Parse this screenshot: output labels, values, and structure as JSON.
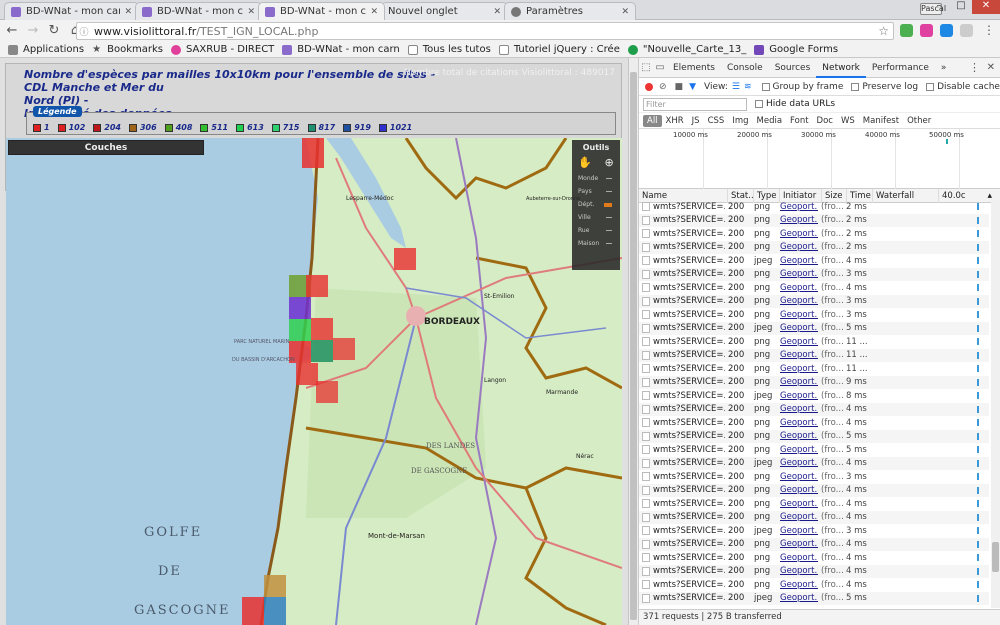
{
  "browser": {
    "tabs": [
      {
        "label": "BD-WNat - mon carnet d",
        "active": false
      },
      {
        "label": "BD-WNat - mon carnet d",
        "active": false
      },
      {
        "label": "BD-WNat - mon carnet d",
        "active": true
      },
      {
        "label": "Nouvel onglet",
        "active": false
      },
      {
        "label": "Paramètres",
        "active": false
      }
    ],
    "profile": "Pascal",
    "url_host": "www.visiolittoral.fr",
    "url_path": "/TEST_IGN_LOCAL.php",
    "bookmarks": [
      {
        "label": "Applications",
        "icon": "apps-grid-icon"
      },
      {
        "label": "Bookmarks",
        "icon": "star-icon"
      },
      {
        "label": "SAXRUB - DIRECT",
        "icon": "saxrub-icon"
      },
      {
        "label": "BD-WNat - mon carn",
        "icon": "bdwnat-icon"
      },
      {
        "label": "Tous les tutos",
        "icon": "page-icon"
      },
      {
        "label": "Tutoriel jQuery : Crée",
        "icon": "page-icon"
      },
      {
        "label": "\"Nouvelle_Carte_13_",
        "icon": "sheets-icon"
      },
      {
        "label": "Google Forms",
        "icon": "forms-icon"
      }
    ]
  },
  "page": {
    "title_line1": "Nombre d'espèces par mailles 10x10km pour l'ensemble de sites - CDL Manche et Mer du",
    "title_line2": "Nord (PI) -",
    "title_line3": "Intégralité des données",
    "total_count": "Nombre total de citations Visiolittoral : 489017",
    "legend_title": "Légende",
    "legend": [
      {
        "label": "1",
        "color": "#e02020"
      },
      {
        "label": "102",
        "color": "#e02020"
      },
      {
        "label": "204",
        "color": "#c0181a"
      },
      {
        "label": "306",
        "color": "#a0641a"
      },
      {
        "label": "408",
        "color": "#50a020"
      },
      {
        "label": "511",
        "color": "#30c030"
      },
      {
        "label": "613",
        "color": "#20d050"
      },
      {
        "label": "715",
        "color": "#30d070"
      },
      {
        "label": "817",
        "color": "#209070"
      },
      {
        "label": "919",
        "color": "#2050a0"
      },
      {
        "label": "1021",
        "color": "#3030d0"
      }
    ],
    "couches_label": "Couches",
    "outils_label": "Outils",
    "zoom_levels": [
      "Monde",
      "Pays",
      "Dépt.",
      "Ville",
      "Rue",
      "Maison"
    ],
    "zoom_current": "Dépt.",
    "map_labels": {
      "golfe": "GOLFE",
      "de": "DE",
      "gascogne": "GASCOGNE",
      "bordeaux": "BORDEAUX",
      "landes": "DES LANDES",
      "de_gascogne": "DE GASCOGNE",
      "mont_de_marsan": "Mont-de-Marsan",
      "lesparre": "Lesparre-Médoc",
      "parc": "PARC NATUREL MARIN",
      "bassin": "DU BASSIN D'ARCACHON",
      "st_emilion": "St-Emilion",
      "marmande": "Marmande",
      "langon": "Langon",
      "nerac": "Nérac",
      "aubeterre": "Aubeterre-sur-Dronne"
    }
  },
  "devtools": {
    "tabs": [
      "Elements",
      "Console",
      "Sources",
      "Network",
      "Performance"
    ],
    "active_tab": "Network",
    "more": "»",
    "view_label": "View:",
    "group_by_frame": "Group by frame",
    "preserve_log": "Preserve log",
    "disable_cache": "Disable cache",
    "filter_placeholder": "Filter",
    "hide_data_urls": "Hide data URLs",
    "types": [
      "All",
      "XHR",
      "JS",
      "CSS",
      "Img",
      "Media",
      "Font",
      "Doc",
      "WS",
      "Manifest",
      "Other"
    ],
    "overview_ticks": [
      "10000 ms",
      "20000 ms",
      "30000 ms",
      "40000 ms",
      "50000 ms"
    ],
    "columns": [
      "Name",
      "Stat...",
      "Type",
      "Initiator",
      "Size",
      "Time",
      "Waterfall",
      "40.0c"
    ],
    "rows": [
      {
        "name": "wmts?SERVICE=...",
        "status": "200",
        "type": "png",
        "init": "Geoport...",
        "size": "(fro...",
        "time": "2 ms"
      },
      {
        "name": "wmts?SERVICE=...",
        "status": "200",
        "type": "png",
        "init": "Geoport...",
        "size": "(fro...",
        "time": "2 ms"
      },
      {
        "name": "wmts?SERVICE=...",
        "status": "200",
        "type": "png",
        "init": "Geoport...",
        "size": "(fro...",
        "time": "2 ms"
      },
      {
        "name": "wmts?SERVICE=...",
        "status": "200",
        "type": "png",
        "init": "Geoport...",
        "size": "(fro...",
        "time": "2 ms"
      },
      {
        "name": "wmts?SERVICE=...",
        "status": "200",
        "type": "jpeg",
        "init": "Geoport...",
        "size": "(fro...",
        "time": "4 ms"
      },
      {
        "name": "wmts?SERVICE=...",
        "status": "200",
        "type": "png",
        "init": "Geoport...",
        "size": "(fro...",
        "time": "3 ms"
      },
      {
        "name": "wmts?SERVICE=...",
        "status": "200",
        "type": "png",
        "init": "Geoport...",
        "size": "(fro...",
        "time": "4 ms"
      },
      {
        "name": "wmts?SERVICE=...",
        "status": "200",
        "type": "png",
        "init": "Geoport...",
        "size": "(fro...",
        "time": "3 ms"
      },
      {
        "name": "wmts?SERVICE=...",
        "status": "200",
        "type": "png",
        "init": "Geoport...",
        "size": "(fro...",
        "time": "3 ms"
      },
      {
        "name": "wmts?SERVICE=...",
        "status": "200",
        "type": "jpeg",
        "init": "Geoport...",
        "size": "(fro...",
        "time": "5 ms"
      },
      {
        "name": "wmts?SERVICE=...",
        "status": "200",
        "type": "png",
        "init": "Geoport...",
        "size": "(fro...",
        "time": "11 ..."
      },
      {
        "name": "wmts?SERVICE=...",
        "status": "200",
        "type": "png",
        "init": "Geoport...",
        "size": "(fro...",
        "time": "11 ..."
      },
      {
        "name": "wmts?SERVICE=...",
        "status": "200",
        "type": "png",
        "init": "Geoport...",
        "size": "(fro...",
        "time": "11 ..."
      },
      {
        "name": "wmts?SERVICE=...",
        "status": "200",
        "type": "png",
        "init": "Geoport...",
        "size": "(fro...",
        "time": "9 ms"
      },
      {
        "name": "wmts?SERVICE=...",
        "status": "200",
        "type": "jpeg",
        "init": "Geoport...",
        "size": "(fro...",
        "time": "8 ms"
      },
      {
        "name": "wmts?SERVICE=...",
        "status": "200",
        "type": "png",
        "init": "Geoport...",
        "size": "(fro...",
        "time": "4 ms"
      },
      {
        "name": "wmts?SERVICE=...",
        "status": "200",
        "type": "png",
        "init": "Geoport...",
        "size": "(fro...",
        "time": "4 ms"
      },
      {
        "name": "wmts?SERVICE=...",
        "status": "200",
        "type": "png",
        "init": "Geoport...",
        "size": "(fro...",
        "time": "5 ms"
      },
      {
        "name": "wmts?SERVICE=...",
        "status": "200",
        "type": "png",
        "init": "Geoport...",
        "size": "(fro...",
        "time": "5 ms"
      },
      {
        "name": "wmts?SERVICE=...",
        "status": "200",
        "type": "jpeg",
        "init": "Geoport...",
        "size": "(fro...",
        "time": "4 ms"
      },
      {
        "name": "wmts?SERVICE=...",
        "status": "200",
        "type": "png",
        "init": "Geoport...",
        "size": "(fro...",
        "time": "3 ms"
      },
      {
        "name": "wmts?SERVICE=...",
        "status": "200",
        "type": "png",
        "init": "Geoport...",
        "size": "(fro...",
        "time": "4 ms"
      },
      {
        "name": "wmts?SERVICE=...",
        "status": "200",
        "type": "png",
        "init": "Geoport...",
        "size": "(fro...",
        "time": "4 ms"
      },
      {
        "name": "wmts?SERVICE=...",
        "status": "200",
        "type": "png",
        "init": "Geoport...",
        "size": "(fro...",
        "time": "4 ms"
      },
      {
        "name": "wmts?SERVICE=...",
        "status": "200",
        "type": "jpeg",
        "init": "Geoport...",
        "size": "(fro...",
        "time": "3 ms"
      },
      {
        "name": "wmts?SERVICE=...",
        "status": "200",
        "type": "png",
        "init": "Geoport...",
        "size": "(fro...",
        "time": "4 ms"
      },
      {
        "name": "wmts?SERVICE=...",
        "status": "200",
        "type": "png",
        "init": "Geoport...",
        "size": "(fro...",
        "time": "4 ms"
      },
      {
        "name": "wmts?SERVICE=...",
        "status": "200",
        "type": "png",
        "init": "Geoport...",
        "size": "(fro...",
        "time": "4 ms"
      },
      {
        "name": "wmts?SERVICE=...",
        "status": "200",
        "type": "png",
        "init": "Geoport...",
        "size": "(fro...",
        "time": "4 ms"
      },
      {
        "name": "wmts?SERVICE=...",
        "status": "200",
        "type": "jpeg",
        "init": "Geoport...",
        "size": "(fro...",
        "time": "5 ms"
      }
    ],
    "status_text": "371 requests | 275 B transferred"
  }
}
